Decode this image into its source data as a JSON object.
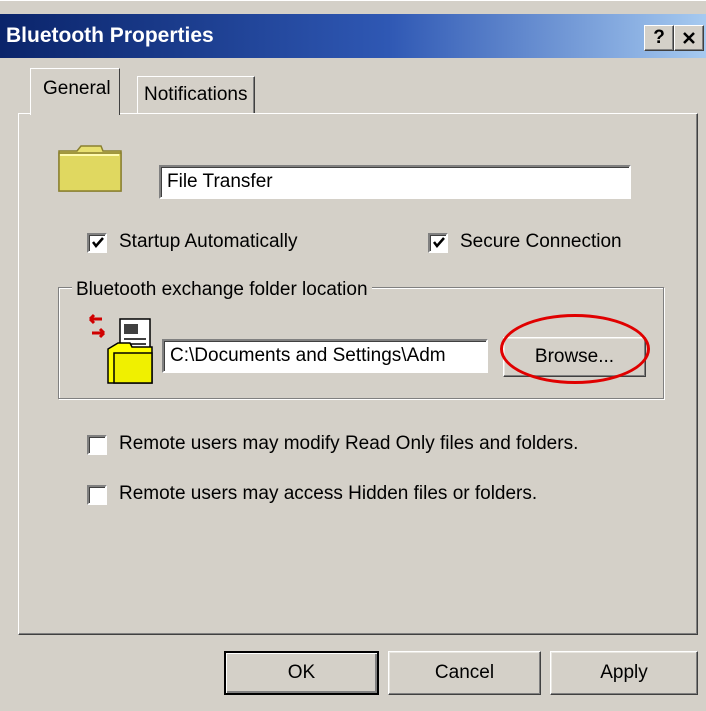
{
  "window": {
    "title": "Bluetooth Properties",
    "help_button": "?",
    "close_button": "✕"
  },
  "tabs": [
    {
      "label": "General",
      "active": true
    },
    {
      "label": "Notifications",
      "active": false
    }
  ],
  "general": {
    "service_icon": "folder-icon",
    "service_name": "File Transfer",
    "startup_automatically": {
      "label": "Startup Automatically",
      "checked": true
    },
    "secure_connection": {
      "label": "Secure Connection",
      "checked": true
    },
    "exchange_folder": {
      "group_label": "Bluetooth exchange folder location",
      "icon": "exchange-folder-icon",
      "path": "C:\\Documents and Settings\\Adm",
      "browse_label": "Browse..."
    },
    "modify_read_only": {
      "label": "Remote users may modify Read Only files and folders.",
      "checked": false
    },
    "access_hidden": {
      "label": "Remote users may access Hidden files or folders.",
      "checked": false
    }
  },
  "buttons": {
    "ok": "OK",
    "cancel": "Cancel",
    "apply": "Apply"
  },
  "annotation": {
    "color": "#e00000",
    "target": "browse-button"
  },
  "colors": {
    "titlebar_start": "#0a246a",
    "titlebar_end": "#a6caf0",
    "face": "#d4d0c8",
    "folder": "#e8e070"
  }
}
